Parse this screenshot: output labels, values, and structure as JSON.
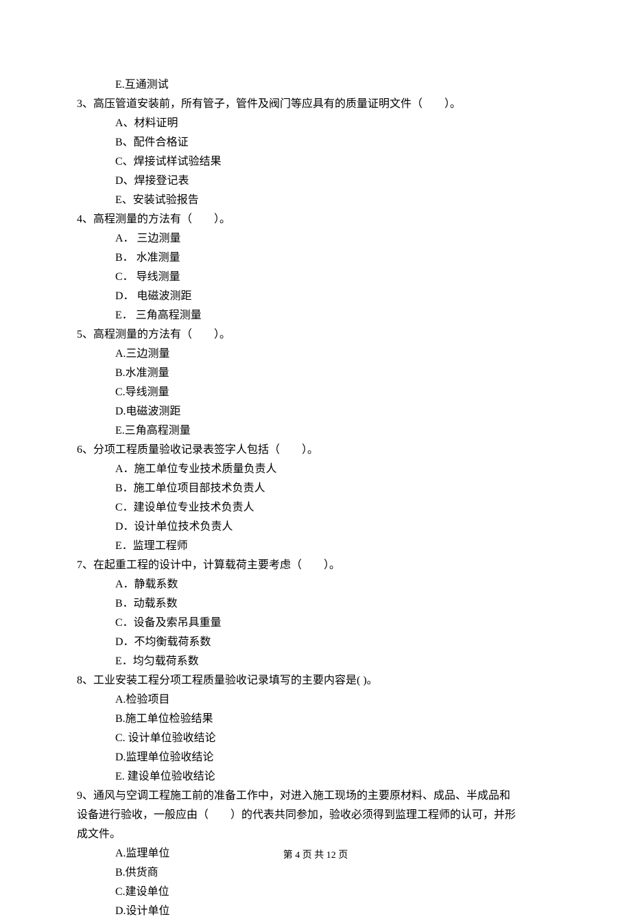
{
  "prevOption": "E.互通测试",
  "questions": [
    {
      "num": "3",
      "text": "高压管道安装前，所有管子，管件及阀门等应具有的质量证明文件（　　）。",
      "options": [
        "A、材料证明",
        "B、配件合格证",
        "C、焊接试样试验结果",
        "D、焊接登记表",
        "E、安装试验报告"
      ]
    },
    {
      "num": "4",
      "text": "高程测量的方法有（　　）。",
      "options": [
        "A． 三边测量",
        "B． 水准测量",
        "C． 导线测量",
        "D． 电磁波测距",
        "E． 三角高程测量"
      ]
    },
    {
      "num": "5",
      "text": "高程测量的方法有（　　）。",
      "options": [
        "A.三边测量",
        "B.水准测量",
        "C.导线测量",
        "D.电磁波测距",
        "E.三角高程测量"
      ]
    },
    {
      "num": "6",
      "text": "分项工程质量验收记录表签字人包括（　　）。",
      "options": [
        "A．施工单位专业技术质量负责人",
        "B．施工单位项目部技术负责人",
        "C．建设单位专业技术负责人",
        "D．设计单位技术负责人",
        "E．监理工程师"
      ]
    },
    {
      "num": "7",
      "text": "在起重工程的设计中，计算载荷主要考虑（　　）。",
      "options": [
        "A．静载系数",
        "B．动载系数",
        "C．设备及索吊具重量",
        "D．不均衡载荷系数",
        "E．均匀载荷系数"
      ]
    },
    {
      "num": "8",
      "text": "工业安装工程分项工程质量验收记录填写的主要内容是(  )。",
      "options": [
        "A.检验项目",
        "B.施工单位检验结果",
        "C. 设计单位验收结论",
        "D.监理单位验收结论",
        "E. 建设单位验收结论"
      ]
    },
    {
      "num": "9",
      "text": "通风与空调工程施工前的准备工作中，对进入施工现场的主要原材料、成品、半成品和",
      "continuation": [
        "设备进行验收，一般应由（　　）的代表共同参加，验收必须得到监理工程师的认可，并形",
        "成文件。"
      ],
      "options": [
        "A.监理单位",
        "B.供货商",
        "C.建设单位",
        "D.设计单位"
      ]
    }
  ],
  "footer": "第 4 页 共 12 页"
}
